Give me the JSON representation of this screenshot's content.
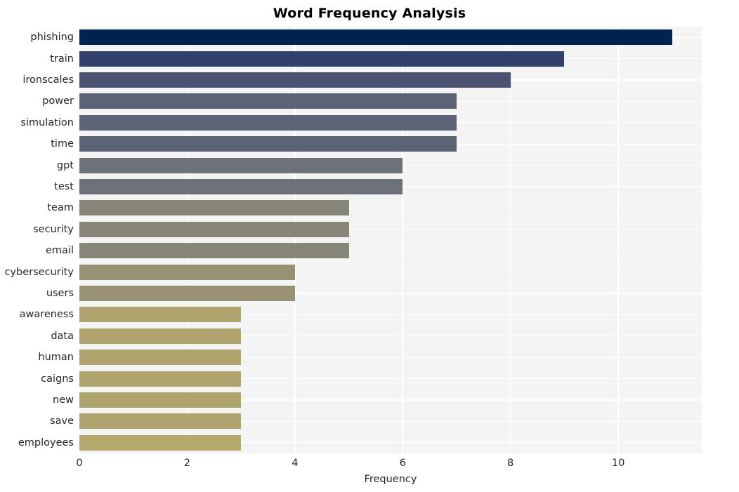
{
  "chart_data": {
    "type": "bar",
    "orientation": "horizontal",
    "title": "Word Frequency Analysis",
    "xlabel": "Frequency",
    "ylabel": "",
    "xlim": [
      0,
      11.55
    ],
    "xticks": [
      0,
      2,
      4,
      6,
      8,
      10
    ],
    "xtick_labels": [
      "0",
      "2",
      "4",
      "6",
      "8",
      "10"
    ],
    "grid": true,
    "legend": null,
    "categories": [
      "phishing",
      "train",
      "ironscales",
      "power",
      "simulation",
      "time",
      "gpt",
      "test",
      "team",
      "security",
      "email",
      "cybersecurity",
      "users",
      "awareness",
      "data",
      "human",
      "caigns",
      "new",
      "save",
      "employees"
    ],
    "values": [
      11,
      9,
      8,
      7,
      7,
      7,
      6,
      6,
      5,
      5,
      5,
      4,
      4,
      3,
      3,
      3,
      3,
      3,
      3,
      3
    ],
    "bar_colors": [
      "#00224e",
      "#32406c",
      "#4a5472",
      "#5c6377",
      "#5c6377",
      "#5c6377",
      "#6d7278",
      "#6d7278",
      "#868577",
      "#868577",
      "#868577",
      "#989173",
      "#989173",
      "#b0a46e",
      "#b0a46e",
      "#b0a46e",
      "#b0a46e",
      "#b0a46e",
      "#b0a46e",
      "#b5a96d"
    ],
    "colormap": "cividis",
    "plot_background": "#f4f4f5",
    "grid_color": "#ffffff",
    "text_color": "#262626",
    "figure_background": "#ffffff"
  }
}
